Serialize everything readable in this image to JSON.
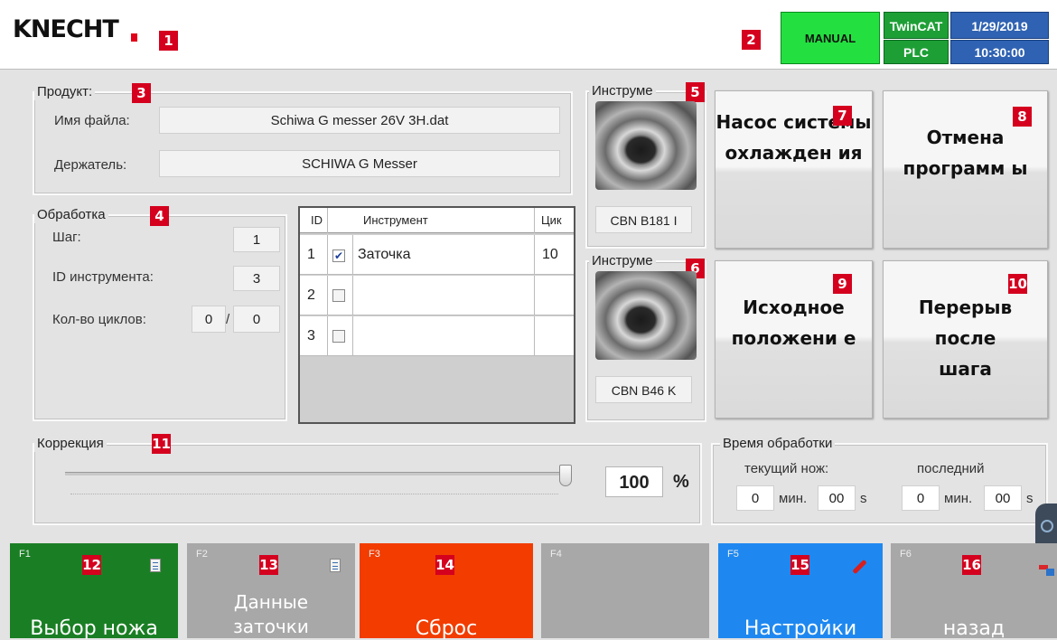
{
  "header": {
    "logo_text": "KNECHT",
    "mode": "MANUAL",
    "twincat": "TwinCAT",
    "plc": "PLC",
    "date": "1/29/2019",
    "time": "10:30:00"
  },
  "markers": [
    "1",
    "2",
    "3",
    "4",
    "5",
    "6",
    "7",
    "8",
    "9",
    "10",
    "11",
    "12",
    "13",
    "14",
    "15",
    "16"
  ],
  "product": {
    "title": "Продукт:",
    "file_label": "Имя файла:",
    "file_value": "Schiwa G messer 26V 3H.dat",
    "holder_label": "Держатель:",
    "holder_value": "SCHIWA G Messer"
  },
  "processing": {
    "title": "Обработка",
    "step_label": "Шаг:",
    "step_value": "1",
    "tool_id_label": "ID инструмента:",
    "tool_id_value": "3",
    "cycles_label": "Кол-во циклов:",
    "cycles_current": "0",
    "cycles_sep": "/",
    "cycles_total": "0"
  },
  "tool_table": {
    "headers": [
      "ID",
      "Инструмент",
      "Цик"
    ],
    "rows": [
      {
        "id": "1",
        "checked": true,
        "name": "Заточка",
        "cycles": "10"
      },
      {
        "id": "2",
        "checked": false,
        "name": "",
        "cycles": ""
      },
      {
        "id": "3",
        "checked": false,
        "name": "",
        "cycles": ""
      }
    ]
  },
  "tool1": {
    "title": "Инструме",
    "label": "CBN B181 I"
  },
  "tool2": {
    "title": "Инструме",
    "label": "CBN B46 K"
  },
  "buttons": {
    "coolant": "Насос системы охлажден ия",
    "cancel": "Отмена программ ы",
    "home": "Исходное положени е",
    "pause": "Перерыв после шага"
  },
  "correction": {
    "title": "Коррекция",
    "value": "100",
    "unit": "%",
    "slider_fraction": 1.0
  },
  "time": {
    "title": "Время обработки",
    "current_label": "текущий нож:",
    "last_label": "последний",
    "cur_min": "0",
    "cur_min_unit": "мин.",
    "cur_sec": "00",
    "cur_sec_unit": "s",
    "last_min": "0",
    "last_min_unit": "мин.",
    "last_sec": "00",
    "last_sec_unit": "s"
  },
  "fkeys": [
    {
      "num": "F1",
      "label": "Выбор ножа",
      "color": "#1a7f24"
    },
    {
      "num": "F2",
      "label": "Данные заточки",
      "color": "#a8a8a8"
    },
    {
      "num": "F3",
      "label": "Сброс",
      "color": "#f23c00"
    },
    {
      "num": "F4",
      "label": "",
      "color": "#a8a8a8"
    },
    {
      "num": "F5",
      "label": "Настройки",
      "color": "#1e88f0"
    },
    {
      "num": "F6",
      "label": "назад",
      "color": "#a8a8a8"
    }
  ],
  "icons": {
    "f1": "document-icon",
    "f2": "document-icon",
    "f5": "wrench-icon",
    "f6": "back-arrow-icon",
    "side": "side-tab-icon"
  }
}
